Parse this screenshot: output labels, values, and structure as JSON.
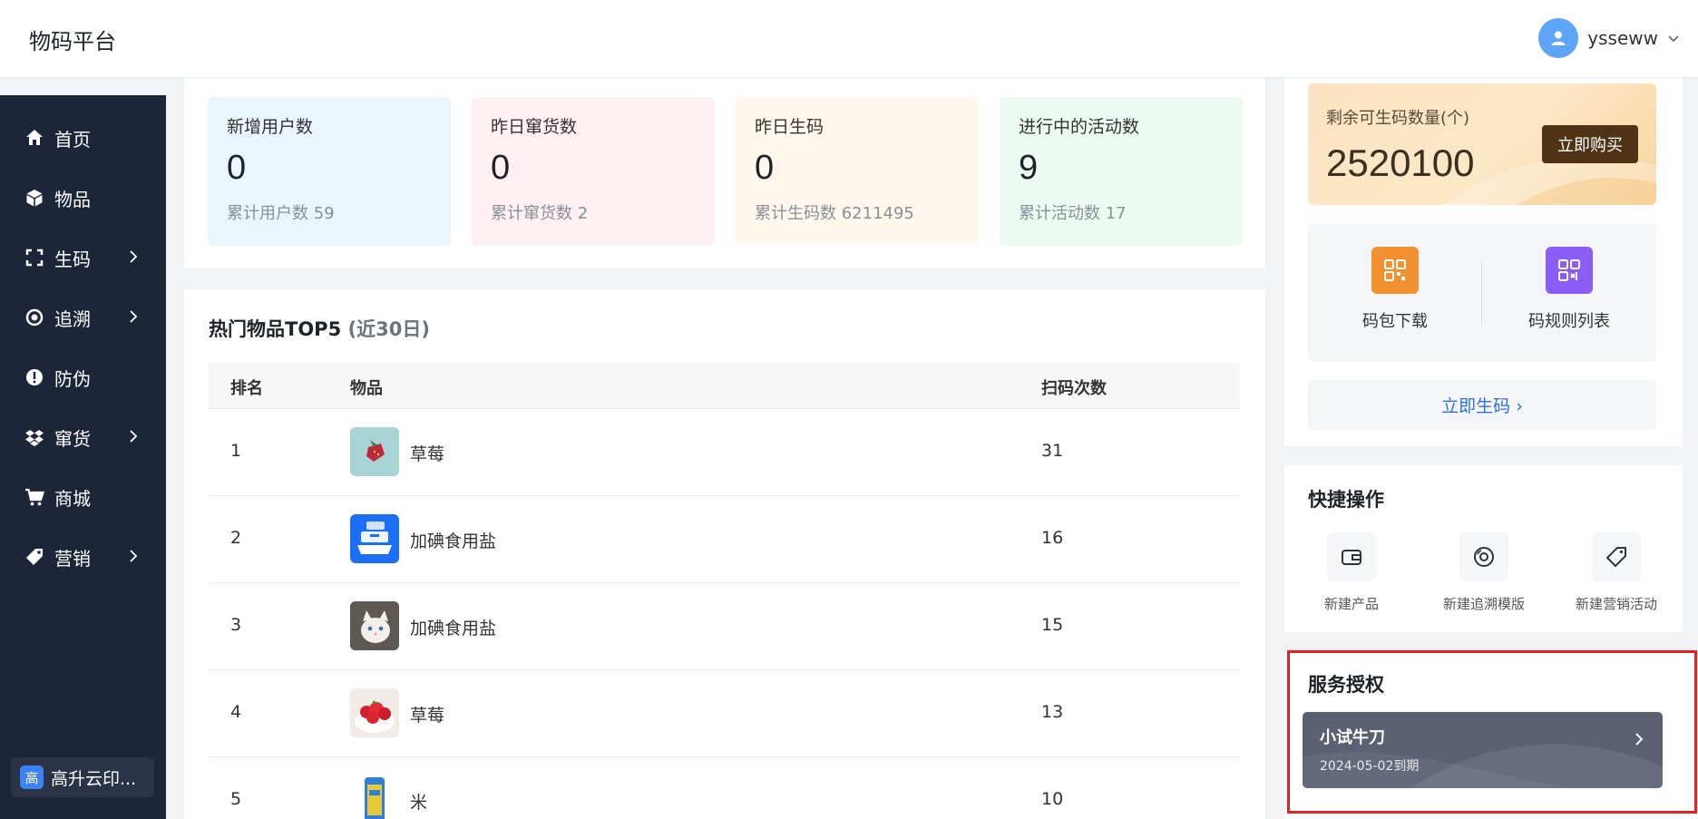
{
  "app": {
    "title": "物码平台"
  },
  "user": {
    "name": "yssеww",
    "avatar_icon": "user-icon",
    "dropdown_icon": "chevron-down-icon"
  },
  "sidebar": {
    "items": [
      {
        "label": "首页",
        "icon": "home-icon",
        "has_submenu": false
      },
      {
        "label": "物品",
        "icon": "cube-icon",
        "has_submenu": false
      },
      {
        "label": "生码",
        "icon": "scan-frame-icon",
        "has_submenu": true
      },
      {
        "label": "追溯",
        "icon": "target-icon",
        "has_submenu": true
      },
      {
        "label": "防伪",
        "icon": "alert-circle-icon",
        "has_submenu": false
      },
      {
        "label": "窜货",
        "icon": "dropbox-icon",
        "has_submenu": true
      },
      {
        "label": "商城",
        "icon": "cart-icon",
        "has_submenu": false
      },
      {
        "label": "营销",
        "icon": "tag-icon",
        "has_submenu": true
      }
    ],
    "tenant": {
      "badge": "高",
      "name": "高升云印..."
    }
  },
  "stats": [
    {
      "label": "新增用户数",
      "value": "0",
      "total": "累计用户数 59",
      "color": "#eaf6fe"
    },
    {
      "label": "昨日窜货数",
      "value": "0",
      "total": "累计窜货数 2",
      "color": "#fff0f3"
    },
    {
      "label": "昨日生码",
      "value": "0",
      "total": "累计生码数 6211495",
      "color": "#fff8eb"
    },
    {
      "label": "进行中的活动数",
      "value": "9",
      "total": "累计活动数 17",
      "color": "#ebfbf1"
    }
  ],
  "top_items": {
    "title": "热门物品TOP5",
    "subtitle": "(近30日)",
    "columns": [
      "排名",
      "物品",
      "扫码次数"
    ],
    "rows": [
      {
        "rank": "1",
        "name": "草莓",
        "count": "31"
      },
      {
        "rank": "2",
        "name": "加碘食用盐",
        "count": "16"
      },
      {
        "rank": "3",
        "name": "加碘食用盐",
        "count": "15"
      },
      {
        "rank": "4",
        "name": "草莓",
        "count": "13"
      },
      {
        "rank": "5",
        "name": "米",
        "count": "10"
      }
    ]
  },
  "quota": {
    "label": "剩余可生码数量(个)",
    "value": "2520100",
    "buy_label": "立即购买"
  },
  "downloads": [
    {
      "label": "码包下载",
      "icon": "qrcode-icon",
      "color": "#f29130"
    },
    {
      "label": "码规则列表",
      "icon": "qrcode-list-icon",
      "color": "#8b5cf6"
    }
  ],
  "generate": {
    "label": "立即生码 ›"
  },
  "quick_actions": {
    "title": "快捷操作",
    "items": [
      {
        "label": "新建产品",
        "icon": "wallet-icon"
      },
      {
        "label": "新建追溯模版",
        "icon": "disc-icon"
      },
      {
        "label": "新建营销活动",
        "icon": "price-tag-icon"
      }
    ]
  },
  "service": {
    "title": "服务授权",
    "plan_name": "小试牛刀",
    "expiry": "2024-05-02到期"
  }
}
